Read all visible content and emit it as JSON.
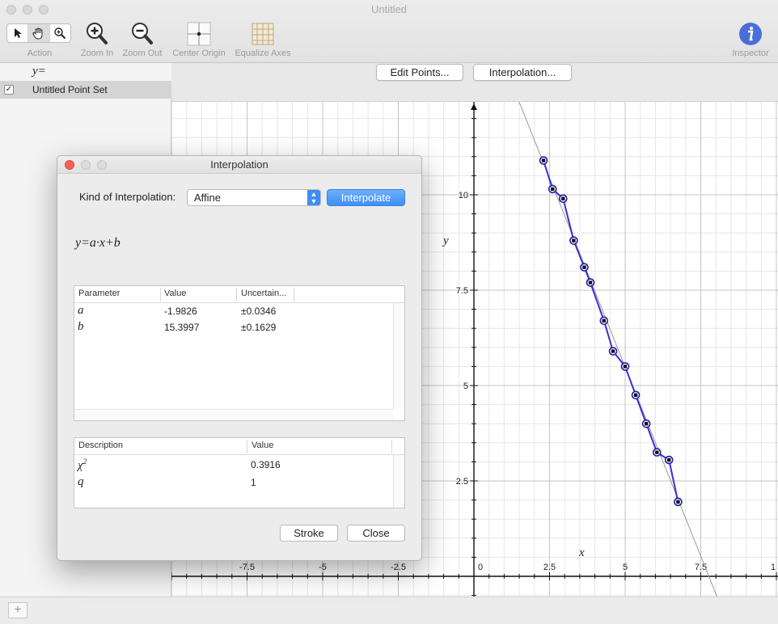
{
  "window": {
    "title": "Untitled"
  },
  "toolbar": {
    "action_label": "Action",
    "zoom_in_label": "Zoom In",
    "zoom_out_label": "Zoom Out",
    "center_origin_label": "Center Origin",
    "equalize_axes_label": "Equalize Axes",
    "inspector_label": "Inspector"
  },
  "sidebar": {
    "y_label": "y=",
    "point_set_label": "Untitled Point Set",
    "point_set_checked": true
  },
  "graph": {
    "edit_points_label": "Edit Points...",
    "interpolation_label": "Interpolation...",
    "x_axis_label": "x",
    "y_axis_label": "y",
    "x_tick_labels": [
      "-7.5",
      "-5",
      "-2.5",
      "0",
      "2.5",
      "5",
      "7.5",
      "1"
    ],
    "y_tick_labels": [
      "10",
      "7.5",
      "5",
      "2.5"
    ],
    "curve_color": "#3a2fd6",
    "fit_line_color": "#9a9a9a",
    "points": [
      [
        2.3,
        10.9
      ],
      [
        2.6,
        10.15
      ],
      [
        2.95,
        9.9
      ],
      [
        3.3,
        8.8
      ],
      [
        3.65,
        8.1
      ],
      [
        3.85,
        7.7
      ],
      [
        4.3,
        6.7
      ],
      [
        4.6,
        5.9
      ],
      [
        5.0,
        5.5
      ],
      [
        5.35,
        4.75
      ],
      [
        5.7,
        4.0
      ],
      [
        6.05,
        3.25
      ],
      [
        6.45,
        3.05
      ],
      [
        6.75,
        1.95
      ]
    ],
    "fit": {
      "a": -1.9826,
      "b": 15.3997
    }
  },
  "dialog": {
    "title": "Interpolation",
    "kind_label": "Kind of Interpolation:",
    "kind_value": "Affine",
    "interpolate_label": "Interpolate",
    "formula": "y=a·x+b",
    "param_headers": [
      "Parameter",
      "Value",
      "Uncertain..."
    ],
    "params": [
      {
        "name": "a",
        "value": "-1.9826",
        "uncertainty": "±0.0346"
      },
      {
        "name": "b",
        "value": "15.3997",
        "uncertainty": "±0.1629"
      }
    ],
    "desc_headers": [
      "Description",
      "Value"
    ],
    "descriptions": [
      {
        "name": "χ",
        "sup": "2",
        "value": "0.3916"
      },
      {
        "name": "q",
        "sup": "",
        "value": "1"
      }
    ],
    "stroke_label": "Stroke",
    "close_label": "Close"
  }
}
